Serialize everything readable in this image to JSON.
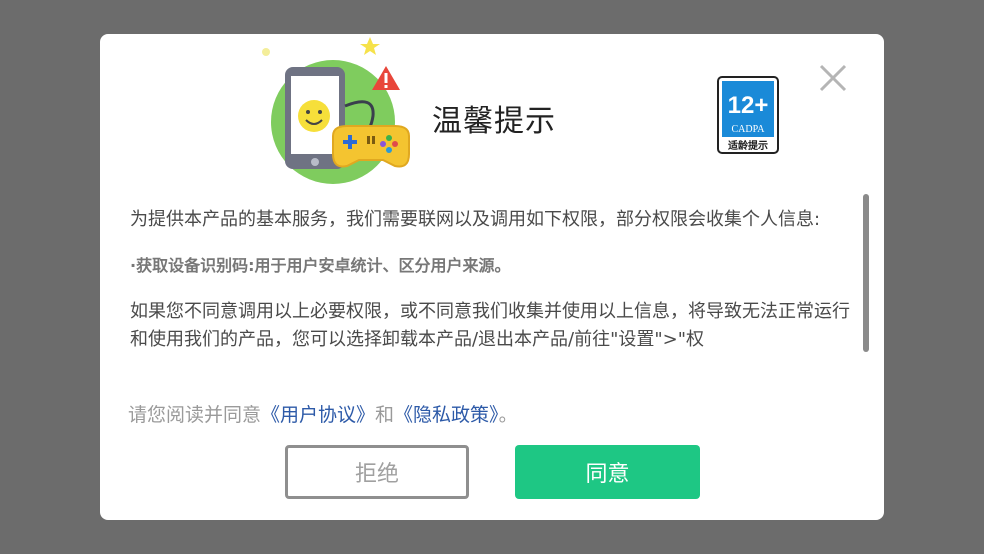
{
  "dialog": {
    "title": "温馨提示",
    "age_badge": {
      "rating": "12+",
      "org": "CADPA",
      "caption": "适龄提示"
    },
    "content": {
      "intro": "为提供本产品的基本服务，我们需要联网以及调用如下权限，部分权限会收集个人信息:",
      "bullet": "·获取设备识别码:用于用户安卓统计、区分用户来源。",
      "notice": "如果您不同意调用以上必要权限，或不同意我们收集并使用以上信息，将导致无法正常运行和使用我们的产品，您可以选择卸载本产品/退出本产品/前往\"设置\">\"权"
    },
    "agreement": {
      "prefix": "请您阅读并同意",
      "user_agreement": "《用户协议》",
      "and": "和",
      "privacy_policy": "《隐私政策》",
      "suffix": "。"
    },
    "buttons": {
      "reject": "拒绝",
      "agree": "同意"
    }
  },
  "colors": {
    "overlay": "#6c6c6c",
    "agree_button": "#1ec784",
    "link": "#2d5aa8",
    "badge_blue": "#1a8ad8"
  }
}
